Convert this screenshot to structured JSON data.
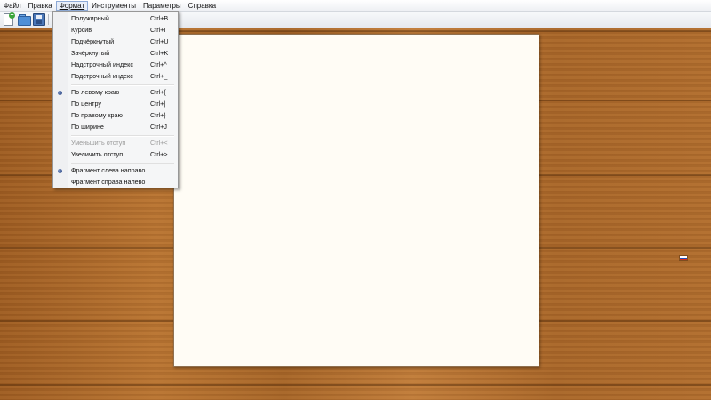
{
  "menubar": {
    "items": [
      "Файл",
      "Правка",
      "Формат",
      "Инструменты",
      "Параметры",
      "Справка"
    ],
    "active_index": 2
  },
  "toolbar": {
    "buttons": [
      "new-document-icon",
      "open-folder-icon",
      "save-disk-icon"
    ]
  },
  "format_menu": {
    "items": [
      {
        "label": "Полужирный",
        "shortcut": "Ctrl+B",
        "disabled": false,
        "checked": false
      },
      {
        "label": "Курсив",
        "shortcut": "Ctrl+I",
        "disabled": false,
        "checked": false
      },
      {
        "label": "Подчёркнутый",
        "shortcut": "Ctrl+U",
        "disabled": false,
        "checked": false
      },
      {
        "label": "Зачёркнутый",
        "shortcut": "Ctrl+K",
        "disabled": false,
        "checked": false
      },
      {
        "label": "Надстрочный индекс",
        "shortcut": "Ctrl+^",
        "disabled": false,
        "checked": false
      },
      {
        "label": "Подстрочный индекс",
        "shortcut": "Ctrl+_",
        "disabled": false,
        "checked": false
      },
      {
        "label": "По левому краю",
        "shortcut": "Ctrl+{",
        "disabled": false,
        "checked": true
      },
      {
        "label": "По центру",
        "shortcut": "Ctrl+|",
        "disabled": false,
        "checked": false
      },
      {
        "label": "По правому краю",
        "shortcut": "Ctrl+}",
        "disabled": false,
        "checked": false
      },
      {
        "label": "По ширине",
        "shortcut": "Ctrl+J",
        "disabled": false,
        "checked": false
      },
      {
        "label": "Уменьшить отступ",
        "shortcut": "Ctrl+<",
        "disabled": true,
        "checked": false
      },
      {
        "label": "Увеличить отступ",
        "shortcut": "Ctrl+>",
        "disabled": false,
        "checked": false
      },
      {
        "label": "Фрагмент слева направо",
        "shortcut": "",
        "disabled": false,
        "checked": true
      },
      {
        "label": "Фрагмент справа налево",
        "shortcut": "",
        "disabled": false,
        "checked": false
      }
    ]
  },
  "language_indicator": {
    "icon": "russian-flag-icon",
    "colors": [
      "#ffffff",
      "#1f4fb8",
      "#d52b1e"
    ]
  },
  "colors": {
    "document_background": "#fffcf5",
    "menu_background": "#f5f6f7",
    "radio_accent": "#1f3a78"
  }
}
